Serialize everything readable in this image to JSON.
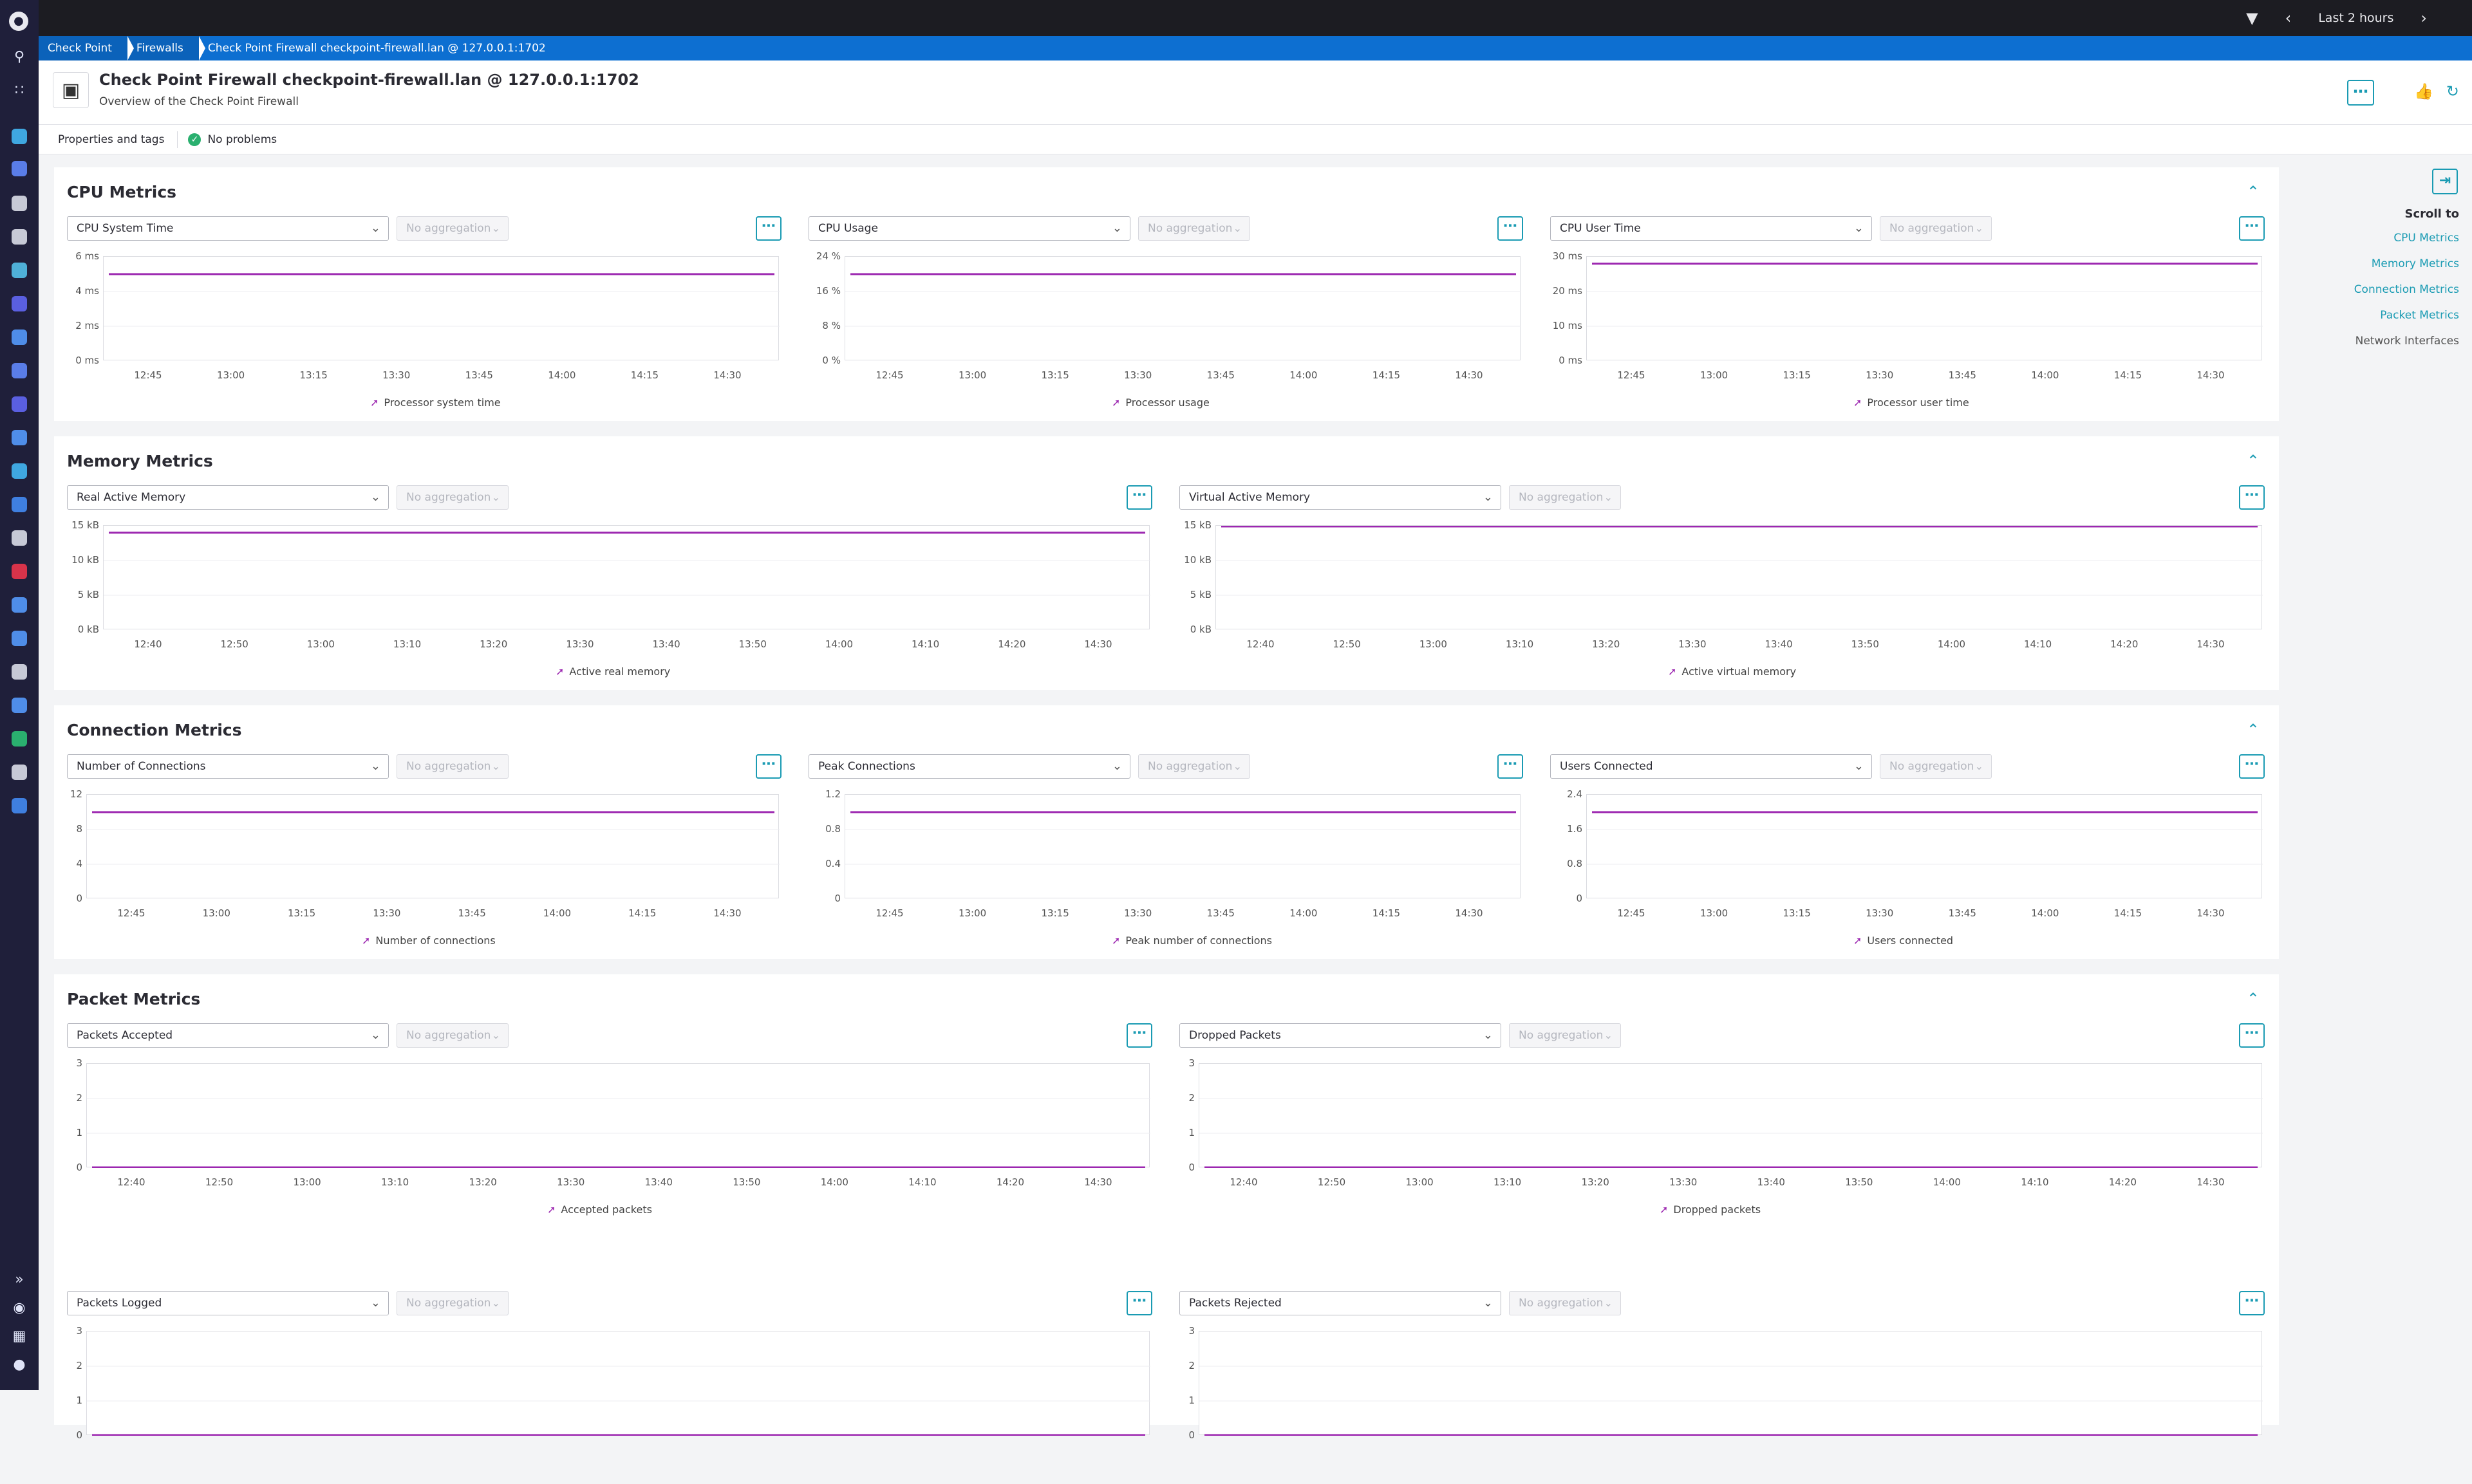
{
  "topbar": {
    "timeframe": "Last 2 hours"
  },
  "breadcrumb": [
    "Check Point",
    "Firewalls",
    "Check Point Firewall checkpoint-firewall.lan @ 127.0.0.1:1702"
  ],
  "header": {
    "title": "Check Point Firewall checkpoint-firewall.lan @ 127.0.0.1:1702",
    "subtitle": "Overview of the Check Point Firewall"
  },
  "props": {
    "tags_label": "Properties and tags",
    "status": "No problems"
  },
  "aggregation_placeholder": "No aggregation",
  "sidenav": {
    "title": "Scroll to",
    "items": [
      "CPU Metrics",
      "Memory Metrics",
      "Connection Metrics",
      "Packet Metrics",
      "Network Interfaces"
    ]
  },
  "colors": {
    "accent": "#1a9bb3",
    "series": "#9c27b0",
    "breadcrumb": "#0d6fd1"
  },
  "sections": [
    {
      "title": "CPU Metrics",
      "charts": [
        {
          "metric": "CPU System Time",
          "legend": "Processor system time",
          "yticks": [
            "6 ms",
            "4 ms",
            "2 ms",
            "0 ms"
          ],
          "xticks": [
            "12:45",
            "13:00",
            "13:15",
            "13:30",
            "13:45",
            "14:00",
            "14:15",
            "14:30"
          ]
        },
        {
          "metric": "CPU Usage",
          "legend": "Processor usage",
          "yticks": [
            "24 %",
            "16 %",
            "8 %",
            "0 %"
          ],
          "xticks": [
            "12:45",
            "13:00",
            "13:15",
            "13:30",
            "13:45",
            "14:00",
            "14:15",
            "14:30"
          ]
        },
        {
          "metric": "CPU User Time",
          "legend": "Processor user time",
          "yticks": [
            "30 ms",
            "20 ms",
            "10 ms",
            "0 ms"
          ],
          "xticks": [
            "12:45",
            "13:00",
            "13:15",
            "13:30",
            "13:45",
            "14:00",
            "14:15",
            "14:30"
          ]
        }
      ]
    },
    {
      "title": "Memory Metrics",
      "charts": [
        {
          "metric": "Real Active Memory",
          "legend": "Active real memory",
          "yticks": [
            "15 kB",
            "10 kB",
            "5 kB",
            "0 kB"
          ],
          "xticks": [
            "12:40",
            "12:50",
            "13:00",
            "13:10",
            "13:20",
            "13:30",
            "13:40",
            "13:50",
            "14:00",
            "14:10",
            "14:20",
            "14:30"
          ]
        },
        {
          "metric": "Virtual Active Memory",
          "legend": "Active virtual memory",
          "yticks": [
            "15 kB",
            "10 kB",
            "5 kB",
            "0 kB"
          ],
          "xticks": [
            "12:40",
            "12:50",
            "13:00",
            "13:10",
            "13:20",
            "13:30",
            "13:40",
            "13:50",
            "14:00",
            "14:10",
            "14:20",
            "14:30"
          ]
        }
      ]
    },
    {
      "title": "Connection Metrics",
      "charts": [
        {
          "metric": "Number of Connections",
          "legend": "Number of connections",
          "yticks": [
            "12",
            "8",
            "4",
            "0"
          ],
          "xticks": [
            "12:45",
            "13:00",
            "13:15",
            "13:30",
            "13:45",
            "14:00",
            "14:15",
            "14:30"
          ]
        },
        {
          "metric": "Peak Connections",
          "legend": "Peak number of connections",
          "yticks": [
            "1.2",
            "0.8",
            "0.4",
            "0"
          ],
          "xticks": [
            "12:45",
            "13:00",
            "13:15",
            "13:30",
            "13:45",
            "14:00",
            "14:15",
            "14:30"
          ]
        },
        {
          "metric": "Users Connected",
          "legend": "Users connected",
          "yticks": [
            "2.4",
            "1.6",
            "0.8",
            "0"
          ],
          "xticks": [
            "12:45",
            "13:00",
            "13:15",
            "13:30",
            "13:45",
            "14:00",
            "14:15",
            "14:30"
          ]
        }
      ]
    },
    {
      "title": "Packet Metrics",
      "charts": [
        {
          "metric": "Packets Accepted",
          "legend": "Accepted packets",
          "yticks": [
            "3",
            "2",
            "1",
            "0"
          ],
          "xticks": [
            "12:40",
            "12:50",
            "13:00",
            "13:10",
            "13:20",
            "13:30",
            "13:40",
            "13:50",
            "14:00",
            "14:10",
            "14:20",
            "14:30"
          ]
        },
        {
          "metric": "Dropped Packets",
          "legend": "Dropped packets",
          "yticks": [
            "3",
            "2",
            "1",
            "0"
          ],
          "xticks": [
            "12:40",
            "12:50",
            "13:00",
            "13:10",
            "13:20",
            "13:30",
            "13:40",
            "13:50",
            "14:00",
            "14:10",
            "14:20",
            "14:30"
          ]
        },
        {
          "metric": "Packets Logged",
          "legend": "",
          "yticks": [
            "3",
            "2",
            "1",
            "0"
          ],
          "xticks": []
        },
        {
          "metric": "Packets Rejected",
          "legend": "",
          "yticks": [
            "3",
            "2",
            "1",
            "0"
          ],
          "xticks": []
        }
      ]
    }
  ],
  "chart_data": [
    {
      "type": "line",
      "title": "CPU System Time",
      "series": [
        {
          "name": "Processor system time",
          "values": [
            5,
            5
          ]
        }
      ],
      "x": [
        "12:35",
        "14:35"
      ],
      "ylim": [
        0,
        6
      ],
      "ylabel": "ms"
    },
    {
      "type": "line",
      "title": "CPU Usage",
      "series": [
        {
          "name": "Processor usage",
          "values": [
            20,
            20
          ]
        }
      ],
      "x": [
        "12:35",
        "14:35"
      ],
      "ylim": [
        0,
        24
      ],
      "ylabel": "%"
    },
    {
      "type": "line",
      "title": "CPU User Time",
      "series": [
        {
          "name": "Processor user time",
          "values": [
            28,
            28
          ]
        }
      ],
      "x": [
        "12:35",
        "14:35"
      ],
      "ylim": [
        0,
        30
      ],
      "ylabel": "ms"
    },
    {
      "type": "line",
      "title": "Real Active Memory",
      "series": [
        {
          "name": "Active real memory",
          "values": [
            14,
            14
          ]
        }
      ],
      "x": [
        "12:35",
        "14:35"
      ],
      "ylim": [
        0,
        15
      ],
      "ylabel": "kB"
    },
    {
      "type": "line",
      "title": "Virtual Active Memory",
      "series": [
        {
          "name": "Active virtual memory",
          "values": [
            15,
            15
          ]
        }
      ],
      "x": [
        "12:35",
        "14:35"
      ],
      "ylim": [
        0,
        15
      ],
      "ylabel": "kB"
    },
    {
      "type": "line",
      "title": "Number of Connections",
      "series": [
        {
          "name": "Number of connections",
          "values": [
            10,
            10
          ]
        }
      ],
      "x": [
        "12:35",
        "14:35"
      ],
      "ylim": [
        0,
        12
      ]
    },
    {
      "type": "line",
      "title": "Peak Connections",
      "series": [
        {
          "name": "Peak number of connections",
          "values": [
            1,
            1
          ]
        }
      ],
      "x": [
        "12:35",
        "14:35"
      ],
      "ylim": [
        0,
        1.2
      ]
    },
    {
      "type": "line",
      "title": "Users Connected",
      "series": [
        {
          "name": "Users connected",
          "values": [
            2,
            2
          ]
        }
      ],
      "x": [
        "12:35",
        "14:35"
      ],
      "ylim": [
        0,
        2.4
      ]
    },
    {
      "type": "line",
      "title": "Packets Accepted",
      "series": [
        {
          "name": "Accepted packets",
          "values": [
            0,
            0
          ]
        }
      ],
      "x": [
        "12:35",
        "14:35"
      ],
      "ylim": [
        0,
        3
      ]
    },
    {
      "type": "line",
      "title": "Dropped Packets",
      "series": [
        {
          "name": "Dropped packets",
          "values": [
            0,
            0
          ]
        }
      ],
      "x": [
        "12:35",
        "14:35"
      ],
      "ylim": [
        0,
        3
      ]
    },
    {
      "type": "line",
      "title": "Packets Logged",
      "series": [
        {
          "values": [
            0,
            0
          ]
        }
      ],
      "x": [
        "12:35",
        "14:35"
      ],
      "ylim": [
        0,
        3
      ]
    },
    {
      "type": "line",
      "title": "Packets Rejected",
      "series": [
        {
          "values": [
            0,
            0
          ]
        }
      ],
      "x": [
        "12:35",
        "14:35"
      ],
      "ylim": [
        0,
        3
      ]
    }
  ]
}
